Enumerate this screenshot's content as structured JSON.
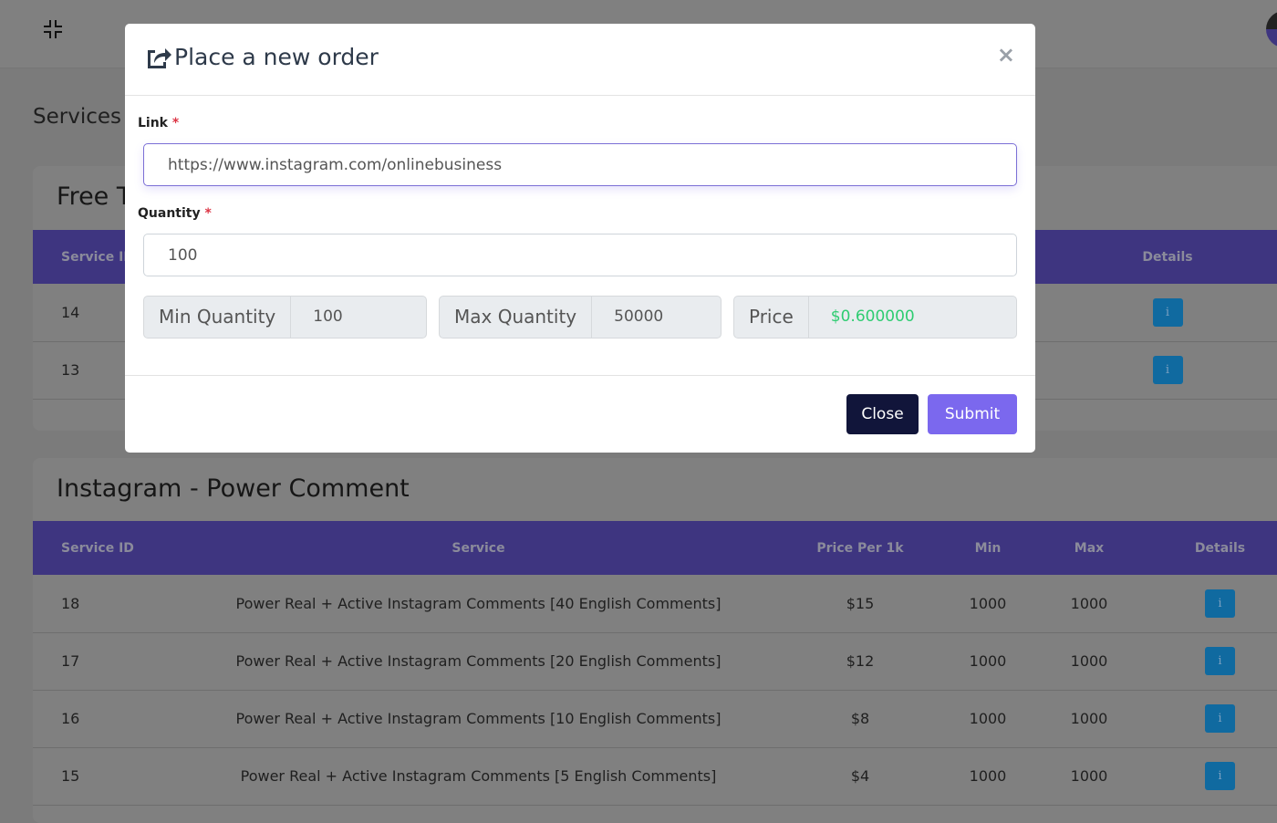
{
  "page": {
    "title": "Services"
  },
  "cards": [
    {
      "title": "Free T",
      "headers": [
        "Service ID",
        "Details"
      ],
      "rows": [
        {
          "id": "14"
        },
        {
          "id": "13"
        }
      ]
    },
    {
      "title": "Instagram - Power Comment",
      "headers": [
        "Service ID",
        "Service",
        "Price Per 1k",
        "Min",
        "Max",
        "Details"
      ],
      "rows": [
        {
          "id": "18",
          "service": "Power Real + Active Instagram Comments [40 English Comments]",
          "price": "$15",
          "min": "1000",
          "max": "1000"
        },
        {
          "id": "17",
          "service": "Power Real + Active Instagram Comments [20 English Comments]",
          "price": "$12",
          "min": "1000",
          "max": "1000"
        },
        {
          "id": "16",
          "service": "Power Real + Active Instagram Comments [10 English Comments]",
          "price": "$8",
          "min": "1000",
          "max": "1000"
        },
        {
          "id": "15",
          "service": "Power Real + Active Instagram Comments [5 English Comments]",
          "price": "$4",
          "min": "1000",
          "max": "1000"
        }
      ]
    }
  ],
  "info_icon": "i",
  "modal": {
    "title": "Place a new order",
    "close_icon": "×",
    "link_label": "Link",
    "required": "*",
    "link_value": "https://www.instagram.com/onlinebusiness",
    "quantity_label": "Quantity",
    "quantity_value": "100",
    "min_label": "Min Quantity",
    "min_value": "100",
    "max_label": "Max Quantity",
    "max_value": "50000",
    "price_label": "Price",
    "price_value": "$0.600000",
    "close_button": "Close",
    "submit_button": "Submit"
  },
  "colors": {
    "accent": "#7b68ee",
    "table_header": "#4d41a8",
    "close_btn": "#11153a",
    "price": "#2ecc71",
    "info_btn": "#1a85c8"
  }
}
